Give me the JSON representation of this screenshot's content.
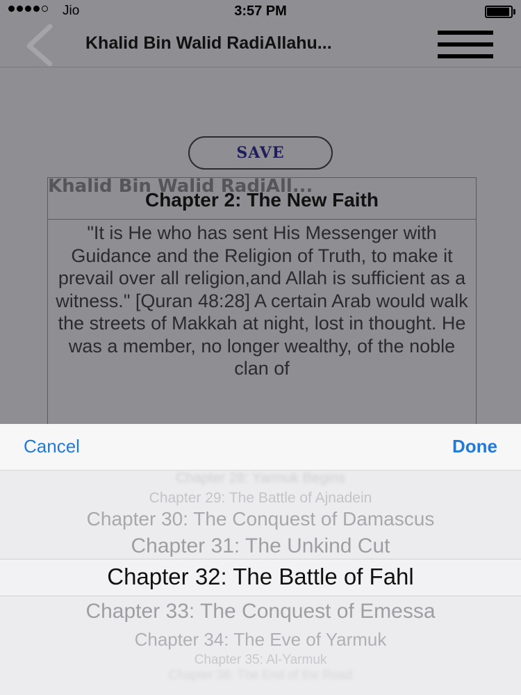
{
  "status_bar": {
    "carrier": "Jio",
    "time": "3:57 PM"
  },
  "nav": {
    "title": "Khalid Bin Walid RadiAllahu..."
  },
  "toolbar": {
    "save_label": "SAVE"
  },
  "book": {
    "title": "Khalid Bin Walid RadiAll...",
    "chapter_title": "Chapter 2: The New Faith",
    "body": "\"It is He who has sent His Messenger with Guidance and the Religion of Truth, to make it prevail over all religion,and Allah is sufficient as a witness.\" [Quran 48:28] A certain Arab would walk the streets of Makkah at night, lost in thought. He was a member, no longer wealthy, of the noble clan of"
  },
  "picker": {
    "cancel_label": "Cancel",
    "done_label": "Done",
    "options": [
      "Chapter 28: Yarmuk Begins",
      "Chapter 29: The Battle of Ajnadein",
      "Chapter 30: The Conquest of Damascus",
      "Chapter 31: The Unkind Cut",
      "Chapter 32: The Battle of Fahl",
      "Chapter 33: The Conquest of Emessa",
      "Chapter 34: The Eve of Yarmuk",
      "Chapter 35: Al-Yarmuk",
      "Chapter 36: The End of the Road"
    ],
    "selected_index": 4
  },
  "icons": {
    "back": "chevron-left-icon",
    "menu": "hamburger-menu-icon"
  },
  "colors": {
    "overlay_gray": "#8e8e93",
    "accent_blue": "#1f7ae0",
    "save_text": "#1f1d5c"
  }
}
